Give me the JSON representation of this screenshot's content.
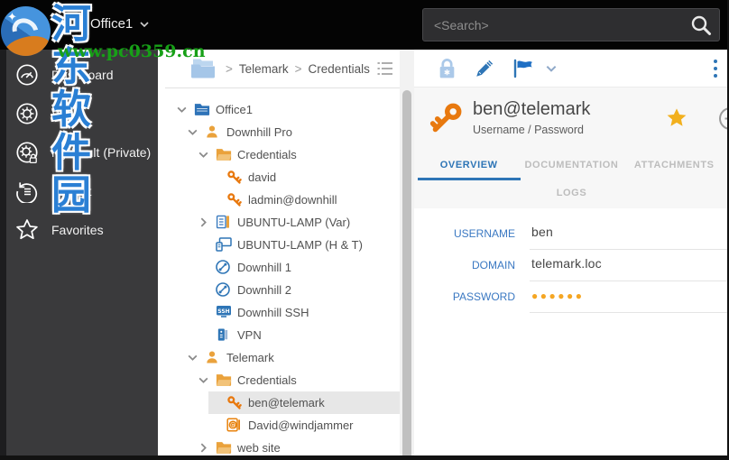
{
  "watermark": {
    "site_name": "河东软件园",
    "site_url": "www.pc0359.cn"
  },
  "topbar": {
    "org_label": "Office1",
    "search_placeholder": "<Search>"
  },
  "sidebar": {
    "items": [
      {
        "slug": "dashboard",
        "label": "Dashboard",
        "icon": "dashboard-icon"
      },
      {
        "slug": "vaults",
        "label": "Vaults",
        "icon": "vault-icon"
      },
      {
        "slug": "my-vault-private",
        "label": "My Vault (Private)",
        "icon": "private-vault-icon"
      },
      {
        "slug": "recent",
        "label": "Recent",
        "icon": "recent-icon"
      },
      {
        "slug": "favorites",
        "label": "Favorites",
        "icon": "star-outline-icon"
      }
    ]
  },
  "breadcrumb": {
    "root_icon": "folders-icon",
    "parts": [
      "Telemark",
      "Credentials"
    ],
    "list_icon": "list-view-icon"
  },
  "tree": {
    "items": [
      {
        "label": "Office1",
        "icon": "folder-blue-icon",
        "level": 0,
        "chevron": "down"
      },
      {
        "label": "Downhill Pro",
        "icon": "user-icon",
        "level": 1,
        "chevron": "down"
      },
      {
        "label": "Credentials",
        "icon": "folder-orange-icon",
        "level": 2,
        "chevron": "down"
      },
      {
        "label": "david",
        "icon": "key-icon",
        "level": 3,
        "chevron": "none"
      },
      {
        "label": "ladmin@downhill",
        "icon": "key-icon",
        "level": 3,
        "chevron": "none"
      },
      {
        "label": "UBUNTU-LAMP (Var)",
        "icon": "list-doc-icon",
        "level": 2,
        "chevron": "right"
      },
      {
        "label": "UBUNTU-LAMP (H & T)",
        "icon": "host-icon",
        "level": 2,
        "chevron": "none"
      },
      {
        "label": "Downhill 1",
        "icon": "remote-icon",
        "level": 2,
        "chevron": "none"
      },
      {
        "label": "Downhill 2",
        "icon": "remote-icon",
        "level": 2,
        "chevron": "none"
      },
      {
        "label": "Downhill SSH",
        "icon": "ssh-icon",
        "level": 2,
        "chevron": "none"
      },
      {
        "label": "VPN",
        "icon": "vpn-icon",
        "level": 2,
        "chevron": "none"
      },
      {
        "label": "Telemark",
        "icon": "user-icon",
        "level": 1,
        "chevron": "down"
      },
      {
        "label": "Credentials",
        "icon": "folder-orange-icon",
        "level": 2,
        "chevron": "down"
      },
      {
        "label": "ben@telemark",
        "icon": "key-icon",
        "level": 3,
        "chevron": "none",
        "selected": true
      },
      {
        "label": "David@windjammer",
        "icon": "web-cred-icon",
        "level": 3,
        "chevron": "none"
      },
      {
        "label": "web site",
        "icon": "folder-orange-icon",
        "level": 2,
        "chevron": "right"
      }
    ]
  },
  "entry": {
    "title": "ben@telemark",
    "subtitle": "Username / Password",
    "favorite": true,
    "tabs": [
      {
        "slug": "overview",
        "label": "OVERVIEW",
        "active": true
      },
      {
        "slug": "documentation",
        "label": "DOCUMENTATION",
        "active": false
      },
      {
        "slug": "attachments",
        "label": "ATTACHMENTS",
        "active": false
      },
      {
        "slug": "logs",
        "label": "LOGS",
        "active": false
      }
    ],
    "fields": [
      {
        "label": "USERNAME",
        "value": "ben"
      },
      {
        "label": "DOMAIN",
        "value": "telemark.loc"
      },
      {
        "label": "PASSWORD",
        "value": "●●●●●●",
        "color": "#f5a623",
        "masked": true
      }
    ]
  },
  "colors": {
    "accent_blue": "#2e75b6",
    "key_orange": "#e8790f",
    "folder_orange": "#eaa23c",
    "favorite_star": "#f2b01e",
    "password_dots": "#f5a623",
    "selected_row": "#e7e7e7",
    "topbar_bg": "#040404",
    "sidebar_bg": "#3a3a3c"
  }
}
